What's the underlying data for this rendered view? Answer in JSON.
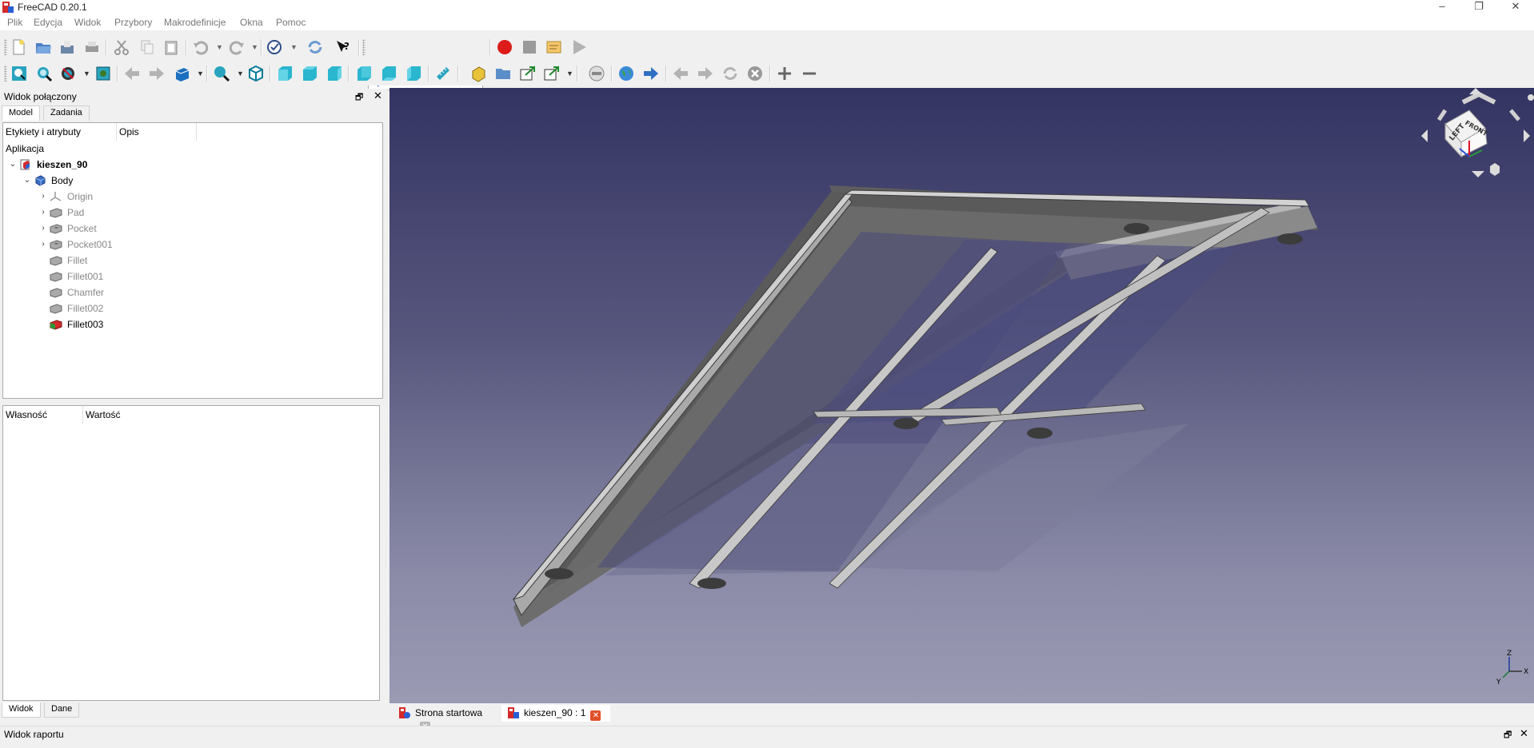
{
  "window": {
    "title": "FreeCAD 0.20.1"
  },
  "menu": [
    "Plik",
    "Edycja",
    "Widok",
    "Przybory",
    "Makrodefinicje",
    "Okna",
    "Pomoc"
  ],
  "toolbar": {
    "workbench_selected": "Start"
  },
  "combo_view": {
    "title": "Widok połączony",
    "tabs": [
      "Model",
      "Zadania"
    ],
    "bottom_tabs": [
      "Widok",
      "Dane"
    ],
    "tree": {
      "col_labels": "Etykiety i atrybuty",
      "col_desc": "Opis",
      "section": "Aplikacja",
      "document": "kieszen_90",
      "body": "Body",
      "features": [
        "Origin",
        "Pad",
        "Pocket",
        "Pocket001",
        "Fillet",
        "Fillet001",
        "Chamfer",
        "Fillet002",
        "Fillet003"
      ]
    },
    "properties": {
      "col_property": "Własność",
      "col_value": "Wartość"
    }
  },
  "doc_tabs": [
    "Strona startowa",
    "kieszen_90 : 1"
  ],
  "report_view": {
    "title": "Widok raportu"
  },
  "navcube": {
    "left_face": "LEFT",
    "front_face": "FRONT"
  },
  "axes": {
    "x": "X",
    "y": "Y",
    "z": "Z"
  }
}
